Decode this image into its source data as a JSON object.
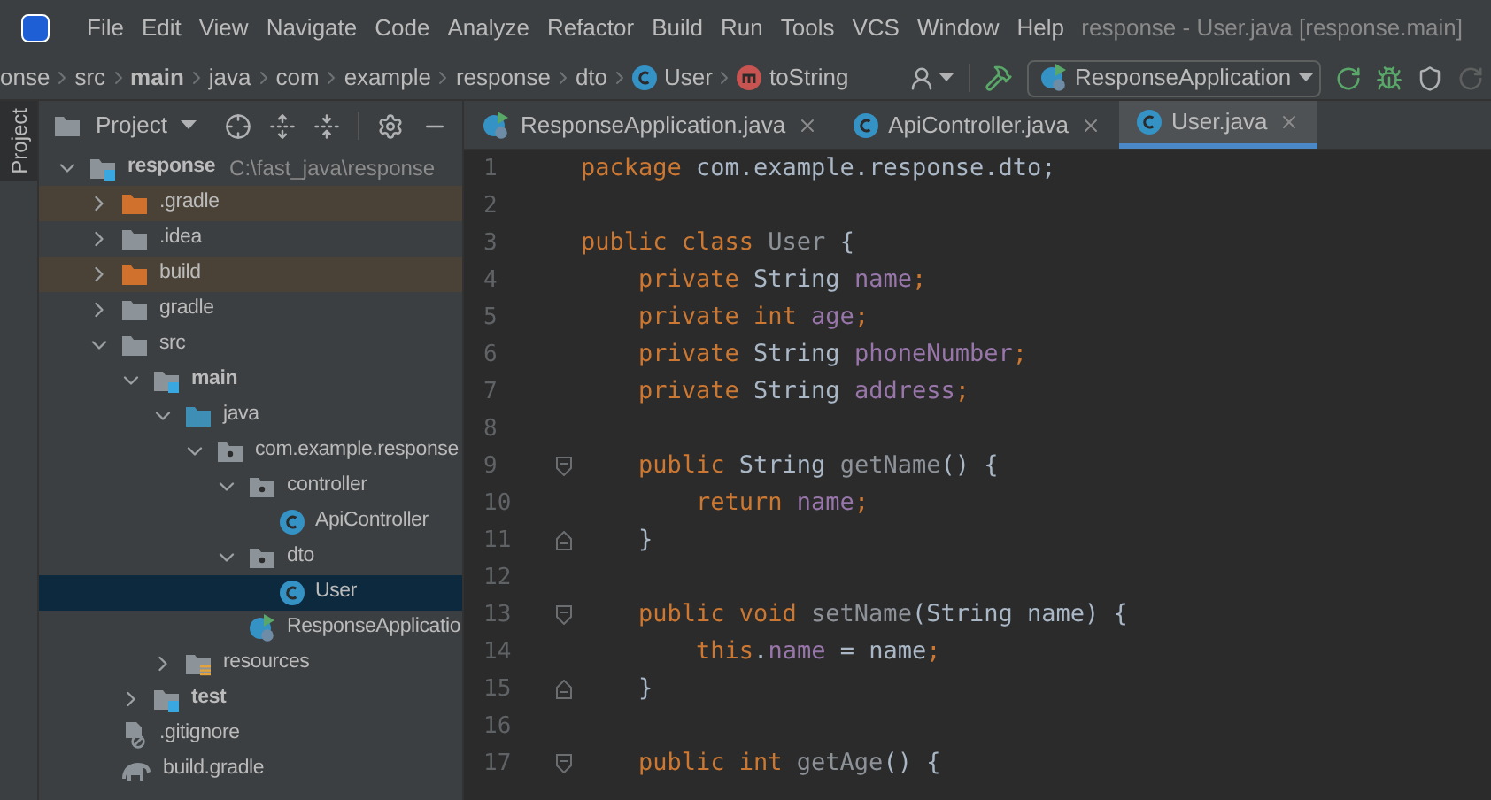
{
  "menu": [
    "File",
    "Edit",
    "View",
    "Navigate",
    "Code",
    "Analyze",
    "Refactor",
    "Build",
    "Run",
    "Tools",
    "VCS",
    "Window",
    "Help"
  ],
  "window": {
    "title": "response - User.java [response.main]"
  },
  "breadcrumbs": [
    {
      "kind": "folder",
      "label": "onse"
    },
    {
      "kind": "folder",
      "label": "src"
    },
    {
      "kind": "module",
      "label": "main"
    },
    {
      "kind": "folder",
      "label": "java"
    },
    {
      "kind": "folder",
      "label": "com"
    },
    {
      "kind": "folder",
      "label": "example"
    },
    {
      "kind": "folder",
      "label": "response"
    },
    {
      "kind": "folder",
      "label": "dto"
    },
    {
      "kind": "class",
      "label": "User"
    },
    {
      "kind": "method",
      "label": "toString"
    }
  ],
  "run_config": {
    "label": "ResponseApplication"
  },
  "tool_stripe": {
    "label": "Project"
  },
  "project_panel": {
    "title": "Project"
  },
  "tree": [
    {
      "kind": "module",
      "name": "response",
      "path": "C:\\fast_java\\response",
      "expanded": true,
      "selected": false,
      "children": [
        {
          "kind": "excluded",
          "name": ".gradle",
          "expanded": false,
          "selected": false
        },
        {
          "kind": "folder",
          "name": ".idea",
          "expanded": false,
          "selected": false
        },
        {
          "kind": "excluded",
          "name": "build",
          "expanded": false,
          "selected": false
        },
        {
          "kind": "folder",
          "name": "gradle",
          "expanded": false,
          "selected": false
        },
        {
          "kind": "folder",
          "name": "src",
          "expanded": true,
          "selected": false,
          "children": [
            {
              "kind": "module",
              "name": "main",
              "expanded": true,
              "selected": false,
              "children": [
                {
                  "kind": "source",
                  "name": "java",
                  "expanded": true,
                  "selected": false,
                  "children": [
                    {
                      "kind": "package",
                      "name": "com.example.response",
                      "expanded": true,
                      "selected": false,
                      "children": [
                        {
                          "kind": "package",
                          "name": "controller",
                          "expanded": true,
                          "selected": false,
                          "children": [
                            {
                              "kind": "class",
                              "name": "ApiController",
                              "selected": false
                            }
                          ]
                        },
                        {
                          "kind": "package",
                          "name": "dto",
                          "expanded": true,
                          "selected": false,
                          "children": [
                            {
                              "kind": "class",
                              "name": "User",
                              "selected": true
                            }
                          ]
                        },
                        {
                          "kind": "app",
                          "name": "ResponseApplicatio",
                          "selected": false
                        }
                      ]
                    }
                  ]
                },
                {
                  "kind": "resources",
                  "name": "resources",
                  "expanded": false,
                  "selected": false
                }
              ]
            },
            {
              "kind": "module",
              "name": "test",
              "expanded": false,
              "selected": false
            }
          ]
        },
        {
          "kind": "ignore",
          "name": ".gitignore",
          "selected": false
        },
        {
          "kind": "gradle",
          "name": "build.gradle",
          "selected": false
        }
      ]
    }
  ],
  "tabs": [
    {
      "kind": "app",
      "label": "ResponseApplication.java",
      "selected": false
    },
    {
      "kind": "class",
      "label": "ApiController.java",
      "selected": false
    },
    {
      "kind": "class",
      "label": "User.java",
      "selected": true
    }
  ],
  "code": [
    {
      "number": "1",
      "tokens": [
        {
          "kind": "keyword",
          "text": "package "
        },
        {
          "kind": "plain",
          "text": "com.example.response.dto;"
        }
      ]
    },
    {
      "number": "2"
    },
    {
      "number": "3",
      "tokens": [
        {
          "kind": "keyword",
          "text": "public class "
        },
        {
          "kind": "unused",
          "text": "User "
        },
        {
          "kind": "plain",
          "text": "{"
        }
      ]
    },
    {
      "number": "4",
      "tokens": [
        {
          "kind": "keyword",
          "text": "    private "
        },
        {
          "kind": "plain",
          "text": "String "
        },
        {
          "kind": "field",
          "text": "name"
        },
        {
          "kind": "keyword",
          "text": ";"
        }
      ]
    },
    {
      "number": "5",
      "tokens": [
        {
          "kind": "keyword",
          "text": "    private int "
        },
        {
          "kind": "field",
          "text": "age"
        },
        {
          "kind": "keyword",
          "text": ";"
        }
      ]
    },
    {
      "number": "6",
      "tokens": [
        {
          "kind": "keyword",
          "text": "    private "
        },
        {
          "kind": "plain",
          "text": "String "
        },
        {
          "kind": "field",
          "text": "phoneNumber"
        },
        {
          "kind": "keyword",
          "text": ";"
        }
      ]
    },
    {
      "number": "7",
      "tokens": [
        {
          "kind": "keyword",
          "text": "    private "
        },
        {
          "kind": "plain",
          "text": "String "
        },
        {
          "kind": "field",
          "text": "address"
        },
        {
          "kind": "keyword",
          "text": ";"
        }
      ]
    },
    {
      "number": "8"
    },
    {
      "number": "9",
      "fold_start": true,
      "tokens": [
        {
          "kind": "keyword",
          "text": "    public "
        },
        {
          "kind": "plain",
          "text": "String "
        },
        {
          "kind": "unused",
          "text": "getName"
        },
        {
          "kind": "plain",
          "text": "() {"
        }
      ]
    },
    {
      "number": "10",
      "tokens": [
        {
          "kind": "keyword",
          "text": "        return "
        },
        {
          "kind": "field",
          "text": "name"
        },
        {
          "kind": "keyword",
          "text": ";"
        }
      ]
    },
    {
      "number": "11",
      "fold_end": true,
      "tokens": [
        {
          "kind": "plain",
          "text": "    }"
        }
      ]
    },
    {
      "number": "12"
    },
    {
      "number": "13",
      "fold_start": true,
      "tokens": [
        {
          "kind": "keyword",
          "text": "    public void "
        },
        {
          "kind": "unused",
          "text": "setName"
        },
        {
          "kind": "plain",
          "text": "(String name) {"
        }
      ]
    },
    {
      "number": "14",
      "tokens": [
        {
          "kind": "keyword",
          "text": "        this"
        },
        {
          "kind": "plain",
          "text": "."
        },
        {
          "kind": "field",
          "text": "name"
        },
        {
          "kind": "plain",
          "text": " = name"
        },
        {
          "kind": "keyword",
          "text": ";"
        }
      ]
    },
    {
      "number": "15",
      "fold_end": true,
      "tokens": [
        {
          "kind": "plain",
          "text": "    }"
        }
      ]
    },
    {
      "number": "16"
    },
    {
      "number": "17",
      "fold_start": true,
      "tokens": [
        {
          "kind": "keyword",
          "text": "    public int "
        },
        {
          "kind": "unused",
          "text": "getAge"
        },
        {
          "kind": "plain",
          "text": "() {"
        }
      ]
    }
  ]
}
